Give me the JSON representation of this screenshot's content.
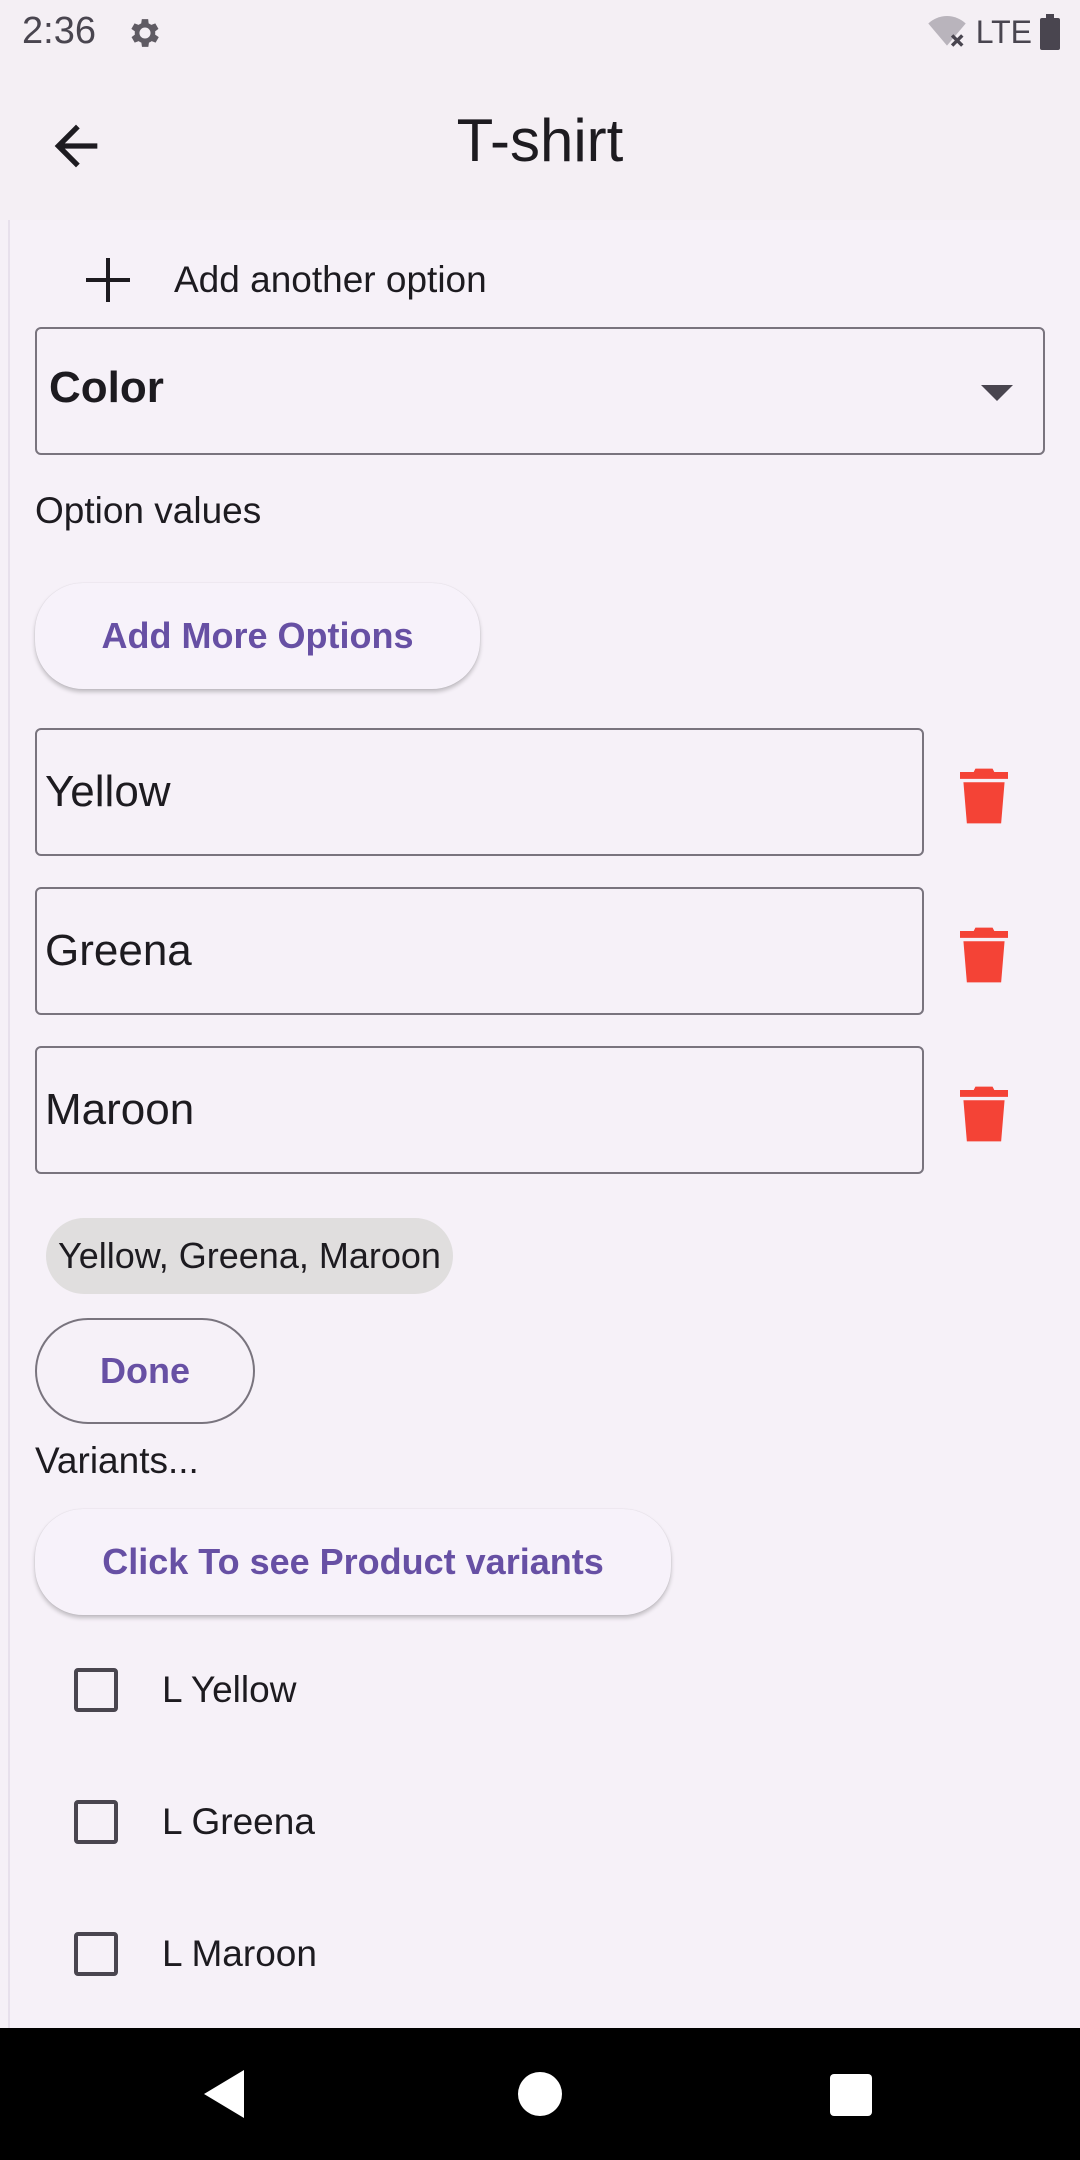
{
  "status": {
    "time": "2:36",
    "network": "LTE"
  },
  "appbar": {
    "title": "T-shirt"
  },
  "add_option": {
    "label": "Add another option"
  },
  "option_select": {
    "value": "Color"
  },
  "option_values": {
    "label": "Option values",
    "add_more_label": "Add More Options",
    "values": [
      "Yellow",
      "Greena",
      "Maroon"
    ],
    "summary_chip": "Yellow, Greena, Maroon",
    "done_label": "Done"
  },
  "variants": {
    "label": "Variants...",
    "see_variants_label": "Click To see Product variants",
    "items": [
      "L Yellow",
      "L Greena",
      "L Maroon"
    ]
  },
  "colors": {
    "accent": "#6750a4",
    "delete": "#f44336",
    "background": "#f6f1f8"
  }
}
